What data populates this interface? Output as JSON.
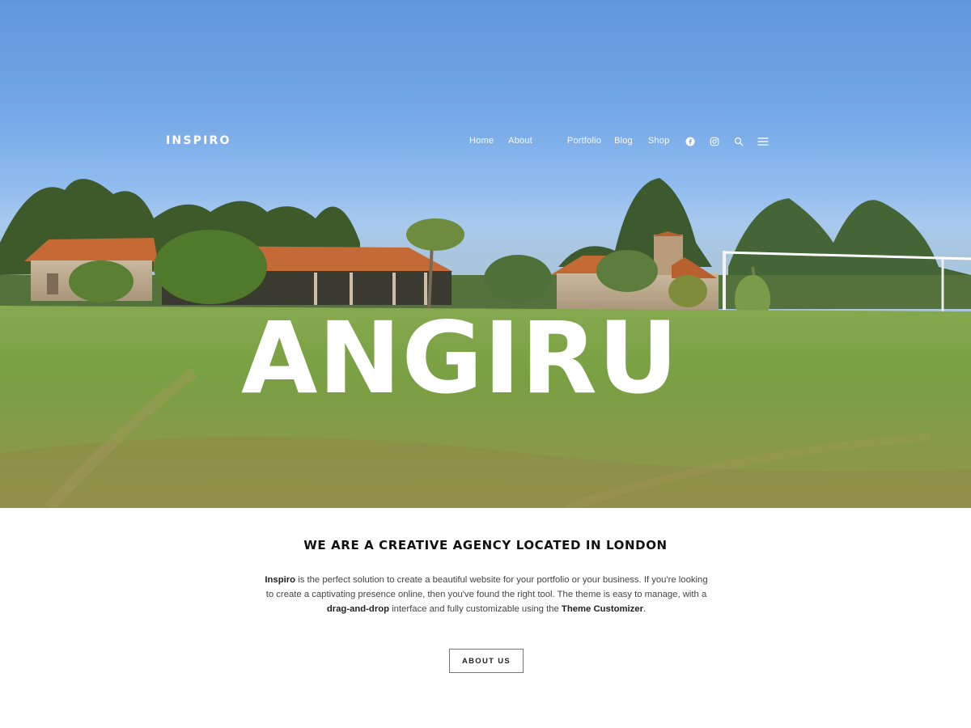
{
  "header": {
    "logo": "INSPIRO",
    "nav": [
      {
        "label": "Home"
      },
      {
        "label": "About"
      },
      {
        "label": "Portfolio"
      },
      {
        "label": "Blog"
      },
      {
        "label": "Shop"
      }
    ],
    "icons": [
      "facebook-icon",
      "instagram-icon",
      "search-icon",
      "menu-icon"
    ]
  },
  "hero": {
    "title": "ANGIRU"
  },
  "intro": {
    "heading": "WE ARE A CREATIVE AGENCY LOCATED IN LONDON",
    "brand": "Inspiro",
    "text_1": " is the perfect solution to create a beautiful website for your portfolio or your business. If you're looking to create a captivating presence online, then you've found the right tool. The theme is easy to manage, with a ",
    "bold_1": "drag-and-drop",
    "text_2": " interface and fully customizable using the ",
    "bold_2": "Theme Customizer",
    "text_3": ".",
    "button_label": "ABOUT US"
  },
  "colors": {
    "sky_top": "#5f97dc",
    "grass": "#6f9a3c",
    "roof": "#c56a35",
    "text_dark": "#111111"
  }
}
